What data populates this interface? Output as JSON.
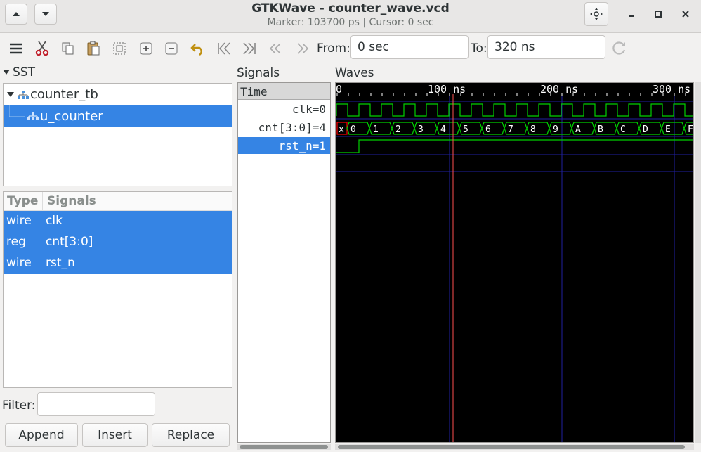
{
  "window": {
    "title": "GTKWave - counter_wave.vcd",
    "subtitle": "Marker: 103700 ps  |  Cursor: 0 sec"
  },
  "toolbar": {
    "from_label": "From:",
    "from_value": "0 sec",
    "to_label": "To:",
    "to_value": "320 ns"
  },
  "sst": {
    "label": "SST",
    "tree": [
      {
        "label": "counter_tb"
      },
      {
        "label": "u_counter"
      }
    ],
    "columns": [
      "Type",
      "Signals"
    ],
    "rows": [
      {
        "type": "wire",
        "signal": "clk"
      },
      {
        "type": "reg",
        "signal": "cnt[3:0]"
      },
      {
        "type": "wire",
        "signal": "rst_n"
      }
    ],
    "filter_label": "Filter:",
    "filter_value": "",
    "buttons": [
      "Append",
      "Insert",
      "Replace"
    ]
  },
  "signals": {
    "label": "Signals",
    "header": "Time",
    "rows": [
      "clk=0",
      "cnt[3:0]=4",
      "rst_n=1"
    ]
  },
  "waves": {
    "label": "Waves",
    "time_labels": [
      "0",
      "100 ns",
      "200 ns",
      "300 ns"
    ],
    "cnt_values": [
      "x",
      "0",
      "1",
      "2",
      "3",
      "4",
      "5",
      "6",
      "7",
      "8",
      "9",
      "A",
      "B",
      "C",
      "D",
      "E",
      "F"
    ],
    "colors": {
      "background": "#000000",
      "trace": "#00d000",
      "grid": "#2020a0",
      "marker": "#ff5050",
      "unknown": "#ff0000"
    }
  }
}
